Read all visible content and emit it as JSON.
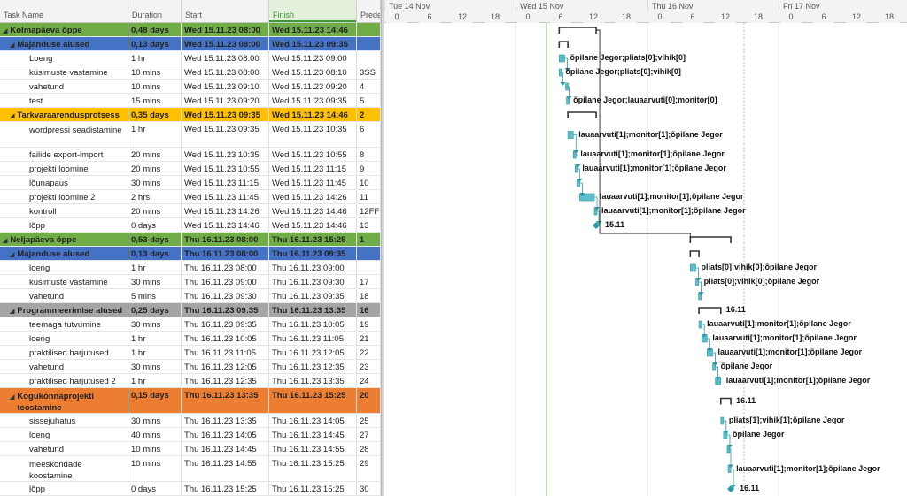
{
  "columns": {
    "name": "Task Name",
    "duration": "Duration",
    "start": "Start",
    "finish": "Finish",
    "pred": "Prede"
  },
  "rows": [
    {
      "level": 0,
      "summary": true,
      "color": "#70ad47",
      "name": "Kolmapäeva õppe",
      "dur": "0,48 days",
      "start": "Wed 15.11.23 08:00",
      "finish": "Wed 15.11.23 14:46",
      "pred": "",
      "h": 16
    },
    {
      "level": 1,
      "summary": true,
      "color": "#4472c4",
      "name": "Majanduse alused",
      "dur": "0,13 days",
      "start": "Wed 15.11.23 08:00",
      "finish": "Wed 15.11.23 09:35",
      "pred": "",
      "h": 16
    },
    {
      "level": 2,
      "name": "Loeng",
      "dur": "1 hr",
      "start": "Wed 15.11.23 08:00",
      "finish": "Wed 15.11.23 09:00",
      "pred": "",
      "h": 16
    },
    {
      "level": 2,
      "name": "küsimuste vastamine",
      "dur": "10 mins",
      "start": "Wed 15.11.23 08:00",
      "finish": "Wed 15.11.23 08:10",
      "pred": "3SS",
      "h": 16
    },
    {
      "level": 2,
      "name": "vahetund",
      "dur": "10 mins",
      "start": "Wed 15.11.23 09:10",
      "finish": "Wed 15.11.23 09:20",
      "pred": "4",
      "h": 16
    },
    {
      "level": 2,
      "name": "test",
      "dur": "15 mins",
      "start": "Wed 15.11.23 09:20",
      "finish": "Wed 15.11.23 09:35",
      "pred": "5",
      "h": 16
    },
    {
      "level": 1,
      "summary": true,
      "color": "#ffc000",
      "name": "Tarkvaraarendusprotsess",
      "dur": "0,35 days",
      "start": "Wed 15.11.23 09:35",
      "finish": "Wed 15.11.23 14:46",
      "pred": "2",
      "h": 16
    },
    {
      "level": 2,
      "name": "wordpressi seadistamine",
      "dur": "1 hr",
      "start": "Wed 15.11.23 09:35",
      "finish": "Wed 15.11.23 10:35",
      "pred": "6",
      "h": 29,
      "wrap": true
    },
    {
      "level": 2,
      "name": "failide export-import",
      "dur": "20 mins",
      "start": "Wed 15.11.23 10:35",
      "finish": "Wed 15.11.23 10:55",
      "pred": "8",
      "h": 16
    },
    {
      "level": 2,
      "name": "projekti loomine",
      "dur": "20 mins",
      "start": "Wed 15.11.23 10:55",
      "finish": "Wed 15.11.23 11:15",
      "pred": "9",
      "h": 16
    },
    {
      "level": 2,
      "name": "lõunapaus",
      "dur": "30 mins",
      "start": "Wed 15.11.23 11:15",
      "finish": "Wed 15.11.23 11:45",
      "pred": "10",
      "h": 16
    },
    {
      "level": 2,
      "name": "projekti loomine 2",
      "dur": "2 hrs",
      "start": "Wed 15.11.23 11:45",
      "finish": "Wed 15.11.23 14:26",
      "pred": "11",
      "h": 16
    },
    {
      "level": 2,
      "name": "kontroll",
      "dur": "20 mins",
      "start": "Wed 15.11.23 14:26",
      "finish": "Wed 15.11.23 14:46",
      "pred": "12FF",
      "h": 16
    },
    {
      "level": 2,
      "name": "lõpp",
      "dur": "0 days",
      "start": "Wed 15.11.23 14:46",
      "finish": "Wed 15.11.23 14:46",
      "pred": "13",
      "h": 16
    },
    {
      "level": 0,
      "summary": true,
      "color": "#70ad47",
      "name": "Neljapäeva õppe",
      "dur": "0,53 days",
      "start": "Thu 16.11.23 08:00",
      "finish": "Thu 16.11.23 15:25",
      "pred": "1",
      "h": 16
    },
    {
      "level": 1,
      "summary": true,
      "color": "#4472c4",
      "name": "Majanduse alused",
      "dur": "0,13 days",
      "start": "Thu 16.11.23 08:00",
      "finish": "Thu 16.11.23 09:35",
      "pred": "",
      "h": 16
    },
    {
      "level": 2,
      "name": "loeng",
      "dur": "1 hr",
      "start": "Thu 16.11.23 08:00",
      "finish": "Thu 16.11.23 09:00",
      "pred": "",
      "h": 16
    },
    {
      "level": 2,
      "name": "küsimuste vastamine",
      "dur": "30 mins",
      "start": "Thu 16.11.23 09:00",
      "finish": "Thu 16.11.23 09:30",
      "pred": "17",
      "h": 16
    },
    {
      "level": 2,
      "name": "vahetund",
      "dur": "5 mins",
      "start": "Thu 16.11.23 09:30",
      "finish": "Thu 16.11.23 09:35",
      "pred": "18",
      "h": 16
    },
    {
      "level": 1,
      "summary": true,
      "color": "#a5a5a5",
      "name": "Programmeerimise alused",
      "dur": "0,25 days",
      "start": "Thu 16.11.23 09:35",
      "finish": "Thu 16.11.23 13:35",
      "pred": "16",
      "h": 16
    },
    {
      "level": 2,
      "name": "teemaga tutvumine",
      "dur": "30 mins",
      "start": "Thu 16.11.23 09:35",
      "finish": "Thu 16.11.23 10:05",
      "pred": "19",
      "h": 16
    },
    {
      "level": 2,
      "name": "loeng",
      "dur": "1 hr",
      "start": "Thu 16.11.23 10:05",
      "finish": "Thu 16.11.23 11:05",
      "pred": "21",
      "h": 16
    },
    {
      "level": 2,
      "name": "praktilised harjutused",
      "dur": "1 hr",
      "start": "Thu 16.11.23 11:05",
      "finish": "Thu 16.11.23 12:05",
      "pred": "22",
      "h": 16
    },
    {
      "level": 2,
      "name": "vahetund",
      "dur": "30 mins",
      "start": "Thu 16.11.23 12:05",
      "finish": "Thu 16.11.23 12:35",
      "pred": "23",
      "h": 16
    },
    {
      "level": 2,
      "name": "praktilised harjutused 2",
      "dur": "1 hr",
      "start": "Thu 16.11.23 12:35",
      "finish": "Thu 16.11.23 13:35",
      "pred": "24",
      "h": 16
    },
    {
      "level": 1,
      "summary": true,
      "color": "#ed7d31",
      "name": "Kogukonnaprojekti teostamine",
      "dur": "0,15 days",
      "start": "Thu 16.11.23 13:35",
      "finish": "Thu 16.11.23 15:25",
      "pred": "20",
      "h": 29,
      "wrap": true
    },
    {
      "level": 2,
      "name": "sissejuhatus",
      "dur": "30 mins",
      "start": "Thu 16.11.23 13:35",
      "finish": "Thu 16.11.23 14:05",
      "pred": "25",
      "h": 16
    },
    {
      "level": 2,
      "name": "loeng",
      "dur": "40 mins",
      "start": "Thu 16.11.23 14:05",
      "finish": "Thu 16.11.23 14:45",
      "pred": "27",
      "h": 16
    },
    {
      "level": 2,
      "name": "vahetund",
      "dur": "10 mins",
      "start": "Thu 16.11.23 14:45",
      "finish": "Thu 16.11.23 14:55",
      "pred": "28",
      "h": 16
    },
    {
      "level": 2,
      "name": "meeskondade koostamine",
      "dur": "10 mins",
      "start": "Thu 16.11.23 14:55",
      "finish": "Thu 16.11.23 15:25",
      "pred": "29",
      "h": 29,
      "wrap": true
    },
    {
      "level": 2,
      "name": "lõpp",
      "dur": "0 days",
      "start": "Thu 16.11.23 15:25",
      "finish": "Thu 16.11.23 15:25",
      "pred": "30",
      "h": 16
    }
  ],
  "timescale": {
    "days": [
      "Tue 14 Nov",
      "Wed 15 Nov",
      "Thu 16 Nov",
      "Fri 17 Nov"
    ],
    "ticks": [
      "0",
      "6",
      "12",
      "18"
    ]
  },
  "gantt_labels": [
    {
      "row": 2,
      "text": "õpilane Jegor;pliats[0];vihik[0]"
    },
    {
      "row": 3,
      "text": "õpilane Jegor;pliats[0];vihik[0]"
    },
    {
      "row": 5,
      "text": "õpilane Jegor;lauaarvuti[0];monitor[0]"
    },
    {
      "row": 7,
      "text": "lauaarvuti[1];monitor[1];õpilane Jegor"
    },
    {
      "row": 8,
      "text": "lauaarvuti[1];monitor[1];õpilane Jegor"
    },
    {
      "row": 9,
      "text": "lauaarvuti[1];monitor[1];õpilane Jegor"
    },
    {
      "row": 11,
      "text": "lauaarvuti[1];monitor[1];õpilane Jegor"
    },
    {
      "row": 12,
      "text": "lauaarvuti[1];monitor[1];õpilane Jegor"
    },
    {
      "row": 13,
      "text": "15.11"
    },
    {
      "row": 16,
      "text": "pliats[0];vihik[0];õpilane Jegor"
    },
    {
      "row": 17,
      "text": "pliats[0];vihik[0];õpilane Jegor"
    },
    {
      "row": 19,
      "text": "16.11"
    },
    {
      "row": 20,
      "text": "lauaarvuti[1];monitor[1];õpilane Jegor"
    },
    {
      "row": 21,
      "text": "lauaarvuti[1];monitor[1];õpilane Jegor"
    },
    {
      "row": 22,
      "text": "lauaarvuti[1];monitor[1];õpilane Jegor"
    },
    {
      "row": 23,
      "text": "õpilane Jegor"
    },
    {
      "row": 24,
      "text": "lauaarvuti[1];monitor[1];õpilane Jegor"
    },
    {
      "row": 25,
      "text": "16.11"
    },
    {
      "row": 26,
      "text": "pliats[1];vihik[1];õpilane Jegor"
    },
    {
      "row": 27,
      "text": "õpilane Jegor"
    },
    {
      "row": 29,
      "text": "lauaarvuti[1];monitor[1];õpilane Jegor"
    },
    {
      "row": 30,
      "text": "16.11"
    }
  ],
  "colors": {
    "bar": "#5bbfcb",
    "bar_dark": "#2f9aa8",
    "summary": "#333333",
    "today": "#8cc37e",
    "milestone": "#2a9bab"
  }
}
